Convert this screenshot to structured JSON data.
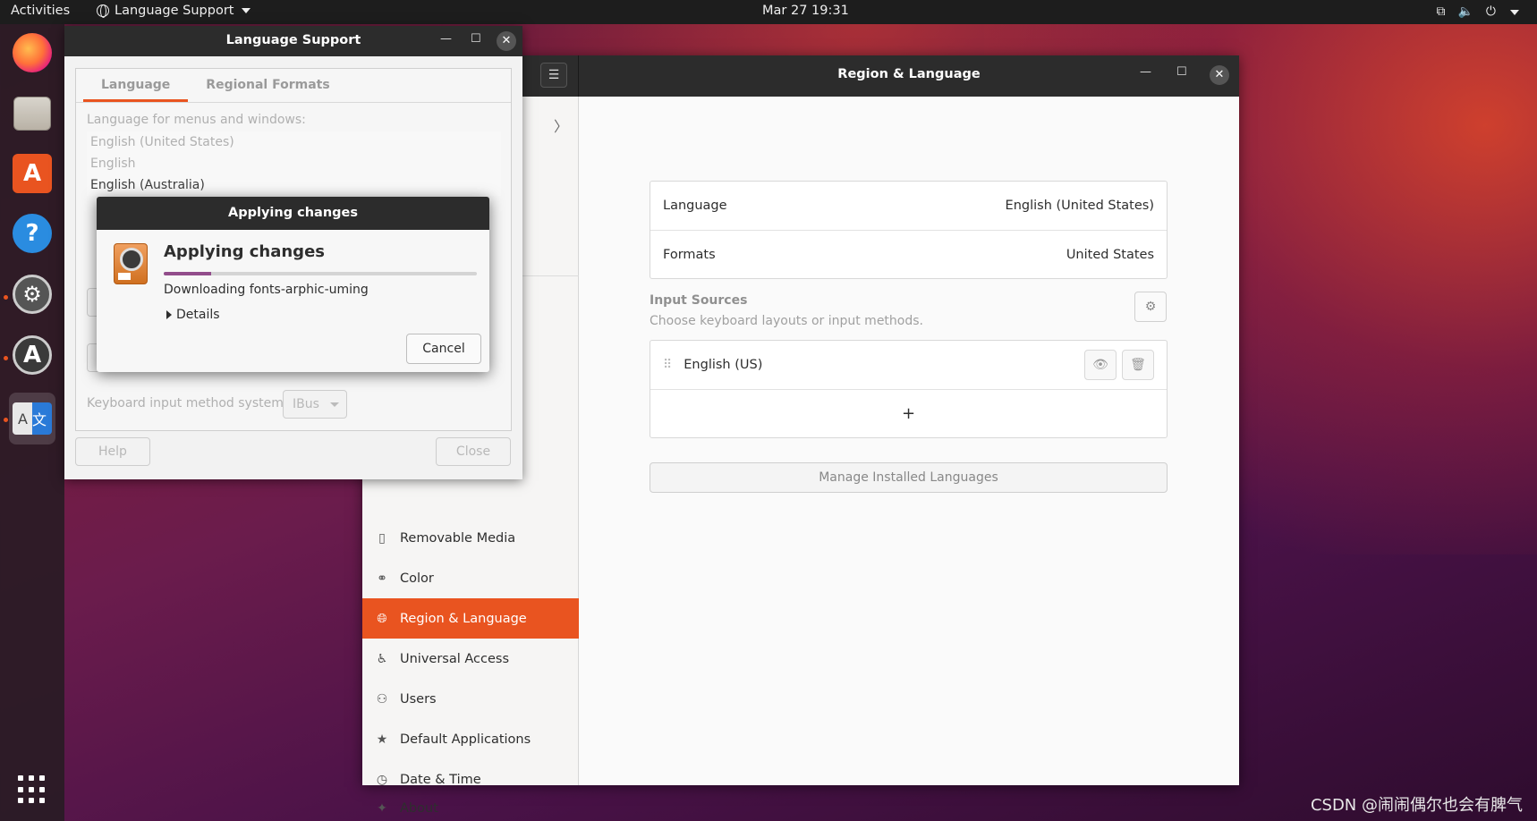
{
  "topbar": {
    "activities": "Activities",
    "app_menu": "Language Support",
    "clock": "Mar 27  19:31"
  },
  "dock": {
    "items": [
      "firefox-icon",
      "files-icon",
      "software-icon",
      "help-icon",
      "settings-icon",
      "software-updater-icon",
      "language-support-icon"
    ]
  },
  "settings_window": {
    "title": "Region & Language",
    "sidebar": {
      "items": [
        {
          "label": "Removable Media",
          "icon": "removable-media-icon"
        },
        {
          "label": "Color",
          "icon": "color-icon"
        },
        {
          "label": "Region & Language",
          "icon": "globe-icon",
          "selected": true
        },
        {
          "label": "Universal Access",
          "icon": "accessibility-icon"
        },
        {
          "label": "Users",
          "icon": "users-icon"
        },
        {
          "label": "Default Applications",
          "icon": "star-icon"
        },
        {
          "label": "Date & Time",
          "icon": "clock-icon"
        },
        {
          "label": "About",
          "icon": "sparkle-icon"
        }
      ]
    },
    "language_label": "Language",
    "language_value": "English (United States)",
    "formats_label": "Formats",
    "formats_value": "United States",
    "input_sources_title": "Input Sources",
    "input_sources_sub": "Choose keyboard layouts or input methods.",
    "input_source": "English (US)",
    "add_symbol": "+",
    "manage_button": "Manage Installed Languages"
  },
  "language_support": {
    "title": "Language Support",
    "tabs": [
      "Language",
      "Regional Formats"
    ],
    "menus_label": "Language for menus and windows:",
    "languages": [
      "English (United States)",
      "English",
      "English (Australia)"
    ],
    "keyboard_label": "Keyboard input method system:",
    "keyboard_value": "IBus",
    "help_button": "Help",
    "close_button": "Close"
  },
  "applying_dialog": {
    "title": "Applying changes",
    "heading": "Applying changes",
    "progress": 0.15,
    "status": "Downloading fonts-arphic-uming",
    "details": "Details",
    "cancel": "Cancel"
  },
  "watermark": "CSDN @闹闹偶尔也会有脾气",
  "colors": {
    "accent": "#e95420",
    "progress": "#924d8b",
    "header": "#2c2c2c"
  }
}
